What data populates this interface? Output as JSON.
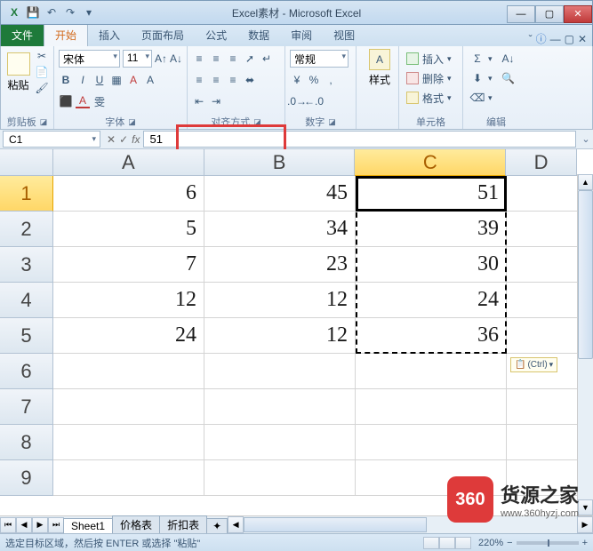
{
  "title": "Excel素材 - Microsoft Excel",
  "qat_icons": [
    "excel-icon",
    "save-icon",
    "undo-icon",
    "redo-icon",
    "qat-menu-icon"
  ],
  "ribbon": {
    "file": "文件",
    "tabs": [
      "开始",
      "插入",
      "页面布局",
      "公式",
      "数据",
      "审阅",
      "视图"
    ],
    "active_tab": "开始",
    "help_icons": [
      "minimize-ribbon-icon",
      "help-icon"
    ],
    "groups": {
      "clipboard": {
        "label": "剪贴板",
        "paste": "粘贴"
      },
      "font": {
        "label": "字体",
        "name": "宋体",
        "size": "11"
      },
      "alignment": {
        "label": "对齐方式"
      },
      "number": {
        "label": "数字",
        "format": "常规"
      },
      "styles": {
        "label": "样式"
      },
      "cells": {
        "label": "单元格",
        "insert": "插入",
        "delete": "删除",
        "format": "格式"
      },
      "editing": {
        "label": "编辑"
      }
    }
  },
  "formula": {
    "name_box": "C1",
    "value": "51"
  },
  "grid": {
    "columns": [
      "A",
      "B",
      "C",
      "D"
    ],
    "active_col": "C",
    "active_row": 1,
    "rows": [
      {
        "n": 1,
        "A": "6",
        "B": "45",
        "C": "51"
      },
      {
        "n": 2,
        "A": "5",
        "B": "34",
        "C": "39"
      },
      {
        "n": 3,
        "A": "7",
        "B": "23",
        "C": "30"
      },
      {
        "n": 4,
        "A": "12",
        "B": "12",
        "C": "24"
      },
      {
        "n": 5,
        "A": "24",
        "B": "12",
        "C": "36"
      },
      {
        "n": 6
      },
      {
        "n": 7
      },
      {
        "n": 8
      },
      {
        "n": 9
      }
    ],
    "paste_tag": "(Ctrl)"
  },
  "sheets": {
    "tabs": [
      "Sheet1",
      "价格表",
      "折扣表"
    ],
    "active": "Sheet1"
  },
  "status": {
    "message": "选定目标区域，然后按 ENTER 或选择 \"粘贴\"",
    "zoom": "220%"
  },
  "watermark": {
    "badge": "360",
    "name": "货源之家",
    "url": "www.360hyzj.com"
  }
}
